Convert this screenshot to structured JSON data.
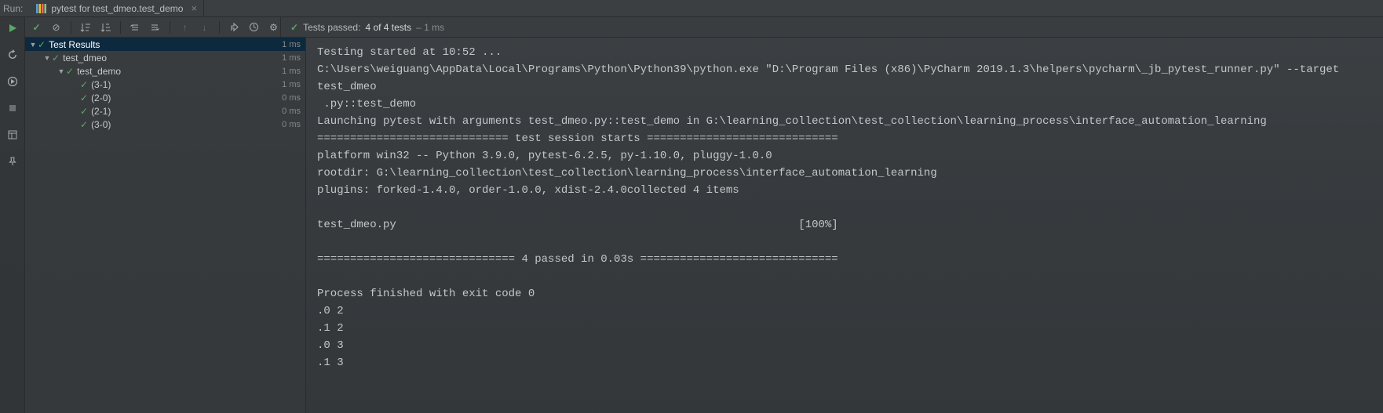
{
  "header": {
    "run_label": "Run:",
    "tab_label": "pytest for test_dmeo.test_demo"
  },
  "status": {
    "prefix": "Tests passed:",
    "counts": "4 of 4 tests",
    "duration": "– 1 ms"
  },
  "tree": {
    "root": {
      "label": "Test Results",
      "time": "1 ms"
    },
    "items": [
      {
        "indent": 1,
        "arrow": true,
        "label": "test_dmeo",
        "time": "1 ms"
      },
      {
        "indent": 2,
        "arrow": true,
        "label": "test_demo",
        "time": "1 ms"
      },
      {
        "indent": 3,
        "arrow": false,
        "label": "(3-1)",
        "time": "1 ms"
      },
      {
        "indent": 3,
        "arrow": false,
        "label": "(2-0)",
        "time": "0 ms"
      },
      {
        "indent": 3,
        "arrow": false,
        "label": "(2-1)",
        "time": "0 ms"
      },
      {
        "indent": 3,
        "arrow": false,
        "label": "(3-0)",
        "time": "0 ms"
      }
    ]
  },
  "console": {
    "lines": [
      "Testing started at 10:52 ...",
      "C:\\Users\\weiguang\\AppData\\Local\\Programs\\Python\\Python39\\python.exe \"D:\\Program Files (x86)\\PyCharm 2019.1.3\\helpers\\pycharm\\_jb_pytest_runner.py\" --target test_dmeo",
      " .py::test_demo",
      "Launching pytest with arguments test_dmeo.py::test_demo in G:\\learning_collection\\test_collection\\learning_process\\interface_automation_learning",
      "============================= test session starts =============================",
      "platform win32 -- Python 3.9.0, pytest-6.2.5, py-1.10.0, pluggy-1.0.0",
      "rootdir: G:\\learning_collection\\test_collection\\learning_process\\interface_automation_learning",
      "plugins: forked-1.4.0, order-1.0.0, xdist-2.4.0collected 4 items",
      "",
      "test_dmeo.py                                                             [100%]",
      "",
      "============================== 4 passed in 0.03s ==============================",
      "",
      "Process finished with exit code 0",
      ".0 2",
      ".1 2",
      ".0 3",
      ".1 3"
    ]
  },
  "icons": {
    "check": "✓",
    "cross": "⊘",
    "sort_abc": "↓≡",
    "sort_time": "↓≣",
    "expand": "⇱",
    "collapse": "⇲",
    "up": "↑",
    "down": "↓",
    "export": "↗",
    "history": "◷",
    "gear": "⚙",
    "run": "▶",
    "rerunfail": "↻",
    "stop": "■",
    "layout": "▦",
    "pin": "📌",
    "close": "×"
  }
}
